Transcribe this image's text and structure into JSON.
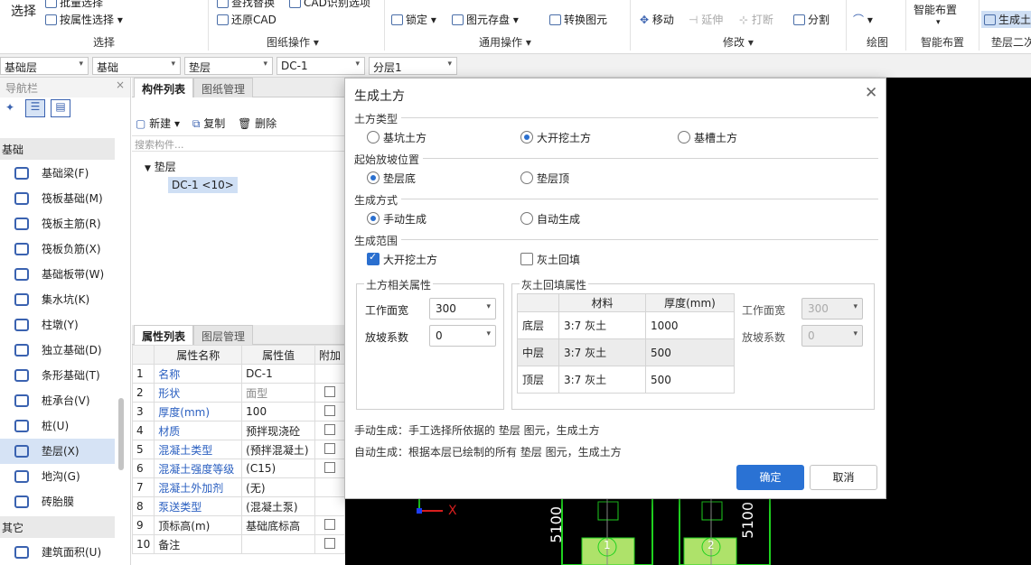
{
  "ribbon": {
    "select_label": "选择",
    "items": {
      "batch_select": "批量选择",
      "prop_select": "按属性选择",
      "restore_cad": "还原CAD",
      "find_image": "查找替换",
      "cad_recog": "CAD识别选项",
      "lock": "锁定",
      "save_elem": "图元存盘",
      "convert_elem": "转换图元",
      "move": "移动",
      "extend": "延伸",
      "break": "打断",
      "split": "分割",
      "smart_layout_top": "智能布置",
      "gen_earth": "生成土方"
    },
    "groups": [
      "选择",
      "图纸操作",
      "通用操作",
      "修改",
      "绘图",
      "智能布置",
      "垫层二次"
    ]
  },
  "filters": [
    "基础层",
    "基础",
    "垫层",
    "DC-1",
    "分层1"
  ],
  "nav": {
    "title": "导航栏",
    "category_main": "基础",
    "items": [
      {
        "label": "基础梁(F)",
        "icon": "beam-icon"
      },
      {
        "label": "筏板基础(M)",
        "icon": "raft-foundation-icon"
      },
      {
        "label": "筏板主筋(R)",
        "icon": "raft-main-rebar-icon"
      },
      {
        "label": "筏板负筋(X)",
        "icon": "raft-neg-rebar-icon"
      },
      {
        "label": "基础板带(W)",
        "icon": "slab-strip-icon"
      },
      {
        "label": "集水坑(K)",
        "icon": "sump-pit-icon"
      },
      {
        "label": "柱墩(Y)",
        "icon": "column-pier-icon"
      },
      {
        "label": "独立基础(D)",
        "icon": "isolated-foundation-icon"
      },
      {
        "label": "条形基础(T)",
        "icon": "strip-foundation-icon"
      },
      {
        "label": "桩承台(V)",
        "icon": "pile-cap-icon"
      },
      {
        "label": "桩(U)",
        "icon": "pile-icon"
      },
      {
        "label": "垫层(X)",
        "icon": "cushion-layer-icon"
      },
      {
        "label": "地沟(G)",
        "icon": "trench-icon"
      },
      {
        "label": "砖胎膜",
        "icon": "brick-mold-icon"
      }
    ],
    "category_other": "其它",
    "other_items": [
      {
        "label": "建筑面积(U)",
        "icon": "building-area-icon"
      }
    ]
  },
  "component_list": {
    "tab_active": "构件列表",
    "tab_inactive": "图纸管理",
    "new_label": "新建",
    "copy_label": "复制",
    "delete_label": "删除",
    "search_placeholder": "搜索构件...",
    "tree_parent": "垫层",
    "tree_child": "DC-1 <10>"
  },
  "property_list": {
    "tab_active": "属性列表",
    "tab_inactive": "图层管理",
    "headers": [
      "属性名称",
      "属性值",
      "附加"
    ],
    "rows": [
      {
        "n": "1",
        "name": "名称",
        "value": "DC-1",
        "blue": true,
        "check": false
      },
      {
        "n": "2",
        "name": "形状",
        "value": "面型",
        "blue": true,
        "check": true,
        "gray": true
      },
      {
        "n": "3",
        "name": "厚度(mm)",
        "value": "100",
        "blue": true,
        "check": true
      },
      {
        "n": "4",
        "name": "材质",
        "value": "预拌现浇砼",
        "blue": true,
        "check": true
      },
      {
        "n": "5",
        "name": "混凝土类型",
        "value": "(预拌混凝土)",
        "blue": true,
        "check": true
      },
      {
        "n": "6",
        "name": "混凝土强度等级",
        "value": "(C15)",
        "blue": true,
        "check": true
      },
      {
        "n": "7",
        "name": "混凝土外加剂",
        "value": "(无)",
        "blue": true,
        "check": false
      },
      {
        "n": "8",
        "name": "泵送类型",
        "value": "(混凝土泵)",
        "blue": true,
        "check": false
      },
      {
        "n": "9",
        "name": "顶标高(m)",
        "value": "基础底标高",
        "blue": false,
        "check": true
      },
      {
        "n": "10",
        "name": "备注",
        "value": "",
        "blue": false,
        "check": true
      }
    ]
  },
  "cad": {
    "dim_left": "5100",
    "dim_right": "5100",
    "axis_x": "X",
    "node_1": "1",
    "node_2": "2"
  },
  "dialog": {
    "title": "生成土方",
    "section_type": "土方类型",
    "type_options": [
      "基坑土方",
      "大开挖土方",
      "基槽土方"
    ],
    "section_start": "起始放坡位置",
    "start_options": [
      "垫层底",
      "垫层顶"
    ],
    "section_method": "生成方式",
    "method_options": [
      "手动生成",
      "自动生成"
    ],
    "section_range": "生成范围",
    "range_options": [
      "大开挖土方",
      "灰土回填"
    ],
    "earth_box_title": "土方相关属性",
    "earth_work_width_label": "工作面宽",
    "earth_work_width": "300",
    "earth_slope_label": "放坡系数",
    "earth_slope": "0",
    "fill_box_title": "灰土回填属性",
    "fill_headers": [
      "材料",
      "厚度(mm)"
    ],
    "fill_rows": [
      {
        "layer": "底层",
        "material": "3:7 灰土",
        "thickness": "1000"
      },
      {
        "layer": "中层",
        "material": "3:7 灰土",
        "thickness": "500"
      },
      {
        "layer": "顶层",
        "material": "3:7 灰土",
        "thickness": "500"
      }
    ],
    "fill_work_width_label": "工作面宽",
    "fill_work_width": "300",
    "fill_slope_label": "放坡系数",
    "fill_slope": "0",
    "note_manual": "手动生成：手工选择所依据的 垫层 图元，生成土方",
    "note_auto": "自动生成：根据本层已绘制的所有 垫层 图元，生成土方",
    "ok_label": "确定",
    "cancel_label": "取消"
  }
}
